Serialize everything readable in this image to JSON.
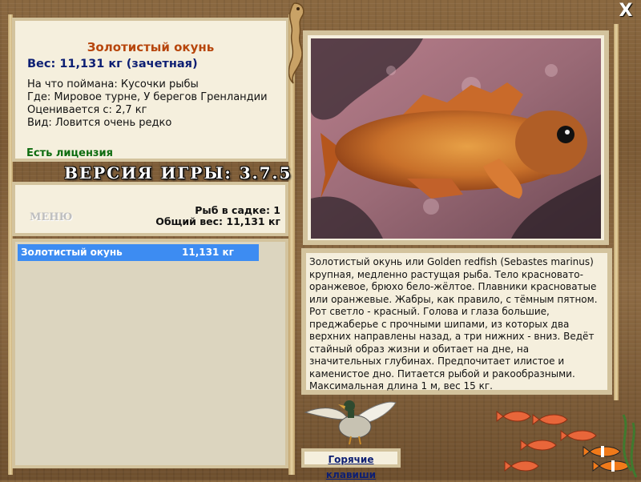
{
  "fish": {
    "title": "Золотистый окунь",
    "weight": "Вес: 11,131 кг (зачетная)",
    "bait": "На что поймана: Кусочки рыбы",
    "location": "Где: Мировое турне, У берегов Гренландии",
    "min_weight": "Оценивается с: 2,7 кг",
    "rarity": "Вид: Ловится очень редко",
    "license": "Есть лицензия"
  },
  "version": "ВЕРСИЯ ИГРЫ: 3.7.5",
  "menu": {
    "label": "МЕНЮ"
  },
  "stats": {
    "fish_count": "Рыб в садке: 1",
    "total_weight": "Общий вес: 11,131 кг"
  },
  "catch_list": [
    {
      "name": "Золотистый окунь",
      "weight": "11,131 кг"
    }
  ],
  "description": "Золотистый окунь или Golden redfish (Sebastes marinus) крупная, медленно растущая рыба. Тело красновато-оранжевое, брюхо бело-жёлтое. Плавники красноватые или оранжевые. Жабры, как правило, с тёмным пятном. Рот светло - красный. Голова и глаза большие, преджаберье с прочными шипами, из которых два верхних направлены назад, а три нижних - вниз. Ведёт стайный образ жизни и обитает на дне, на значительных глубинах. Предпочитает илистое и каменистое дно. Питается рыбой и ракообразными. Максимальная длина 1 м, вес 15 кг.",
  "hotkeys": {
    "label": "Горячие клавиши"
  },
  "close": {
    "label": "X"
  },
  "icons": {
    "close": "close-icon",
    "duck": "duck-icon",
    "fish_school": "fish-icon",
    "seahorse": "seahorse-icon"
  },
  "colors": {
    "title": "#b7460c",
    "weight": "#0d1f73",
    "license": "#0e6c10",
    "selection": "#3d8cf2",
    "panel": "#f5efdd"
  }
}
